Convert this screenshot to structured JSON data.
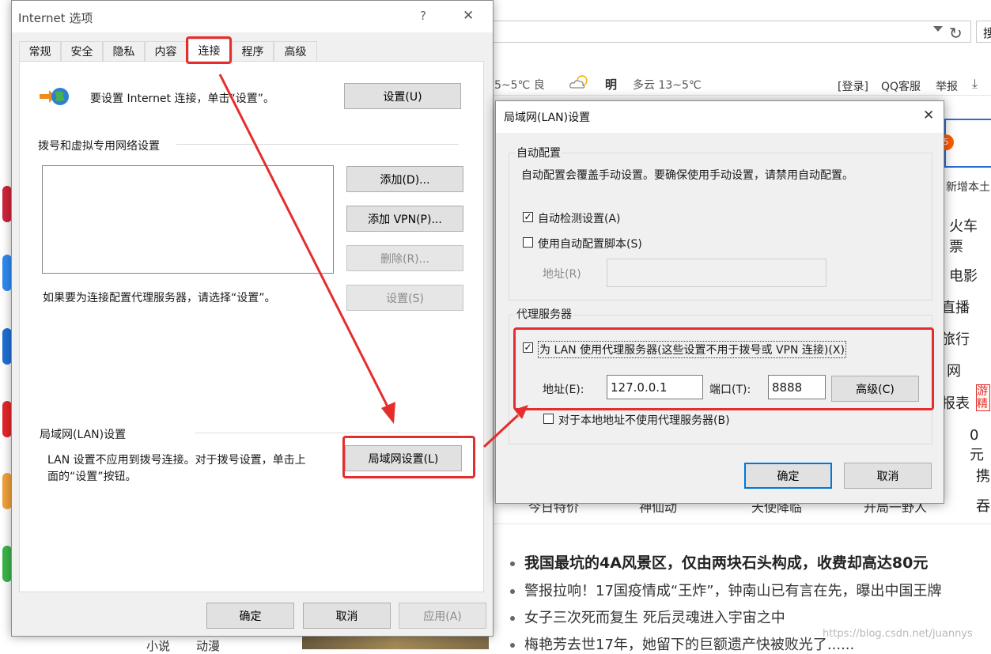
{
  "browser": {
    "search_btn": "搜",
    "weather_left": "5~5℃ 良",
    "weather_day": "明",
    "weather_right": "多云 13~5℃",
    "login": "[登录]",
    "qq_service": "QQ客服",
    "report": "举报",
    "right_col": [
      "新增本土",
      "火车票",
      "电影",
      "直播",
      "旅行",
      "网",
      "报表",
      "0元",
      "携",
      "吞"
    ],
    "ad_text": "游精",
    "bottom_row": [
      "今日特价",
      "神仙动",
      "天使降临",
      "开局一野人"
    ],
    "news": [
      "我国最坑的4A风景区，仅由两块石头构成，收费却高达80元",
      "警报拉响！17国疫情成“王炸”，钟南山已有言在先，曝出中国王牌",
      "女子三次死而复生 死后灵魂进入宇宙之中",
      "梅艳芳去世17年，她留下的巨额遗产快被败光了......"
    ],
    "bottom_tabs": [
      "小说",
      "动漫"
    ],
    "watermark": "https://blog.csdn.net/juannys"
  },
  "internet_options": {
    "title": "Internet 选项",
    "help": "?",
    "close": "✕",
    "tabs": [
      "常规",
      "安全",
      "隐私",
      "内容",
      "连接",
      "程序",
      "高级"
    ],
    "setup_text": "要设置 Internet 连接，单击“设置”。",
    "setup_button": "设置(U)",
    "dialup_heading": "拨号和虚拟专用网络设置",
    "add_button": "添加(D)...",
    "add_vpn_button": "添加 VPN(P)...",
    "delete_button": "删除(R)...",
    "proxy_text": "如果要为连接配置代理服务器，请选择“设置”。",
    "settings_button": "设置(S)",
    "lan_heading": "局域网(LAN)设置",
    "lan_text_1": "LAN 设置不应用到拨号连接。对于拨号设置，单击上",
    "lan_text_2": "面的“设置”按钮。",
    "lan_button": "局域网设置(L)",
    "ok": "确定",
    "cancel": "取消",
    "apply": "应用(A)"
  },
  "lan_dialog": {
    "title": "局域网(LAN)设置",
    "close": "✕",
    "auto_group": "自动配置",
    "auto_desc": "自动配置会覆盖手动设置。要确保使用手动设置，请禁用自动配置。",
    "auto_detect": "自动检测设置(A)",
    "auto_detect_checked": true,
    "auto_script": "使用自动配置脚本(S)",
    "auto_script_checked": false,
    "address_label": "地址(R)",
    "proxy_group": "代理服务器",
    "use_proxy": "为 LAN 使用代理服务器(这些设置不用于拨号或 VPN 连接)(X)",
    "use_proxy_checked": true,
    "proxy_address_label": "地址(E):",
    "proxy_address": "127.0.0.1",
    "port_label": "端口(T):",
    "port": "8888",
    "advanced_button": "高级(C)",
    "bypass_local": "对于本地地址不使用代理服务器(B)",
    "bypass_local_checked": false,
    "ok": "确定",
    "cancel": "取消"
  },
  "colors": {
    "annotation_red": "#e52d2d",
    "focus_blue": "#0078d7"
  }
}
